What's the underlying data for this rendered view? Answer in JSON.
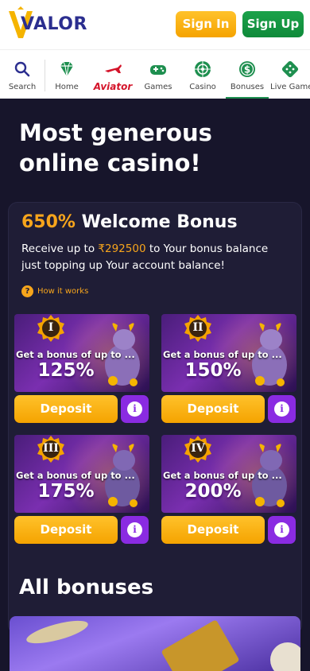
{
  "header": {
    "logo_text": "VALOR",
    "signin_label": "Sign In",
    "signup_label": "Sign Up"
  },
  "nav": {
    "items": [
      {
        "label": "Search",
        "icon": "search-icon"
      },
      {
        "label": "Home",
        "icon": "diamond-icon"
      },
      {
        "label": "Aviator",
        "icon": "plane-icon"
      },
      {
        "label": "Games",
        "icon": "gamepad-icon"
      },
      {
        "label": "Casino",
        "icon": "roulette-icon"
      },
      {
        "label": "Bonuses",
        "icon": "dollar-coin-icon",
        "active": true
      },
      {
        "label": "Live Games",
        "icon": "dice-icon"
      }
    ]
  },
  "hero": {
    "title": "Most generous online casino!"
  },
  "welcome": {
    "percent": "650%",
    "title": " Welcome Bonus",
    "desc_before": "Receive up to ",
    "amount": "₹292500",
    "desc_after": " to Your bonus balance just topping up Your account balance!",
    "how_icon": "?",
    "how_label": "How it works"
  },
  "cards": [
    {
      "numeral": "I",
      "text": "Get a bonus of up to ...",
      "percent": "125%",
      "deposit": "Deposit",
      "info": "i"
    },
    {
      "numeral": "II",
      "text": "Get a bonus of up to ...",
      "percent": "150%",
      "deposit": "Deposit",
      "info": "i"
    },
    {
      "numeral": "III",
      "text": "Get a bonus of up to ...",
      "percent": "175%",
      "deposit": "Deposit",
      "info": "i"
    },
    {
      "numeral": "IV",
      "text": "Get a bonus of up to ...",
      "percent": "200%",
      "deposit": "Deposit",
      "info": "i"
    }
  ],
  "all_bonuses": {
    "title": "All bonuses"
  },
  "colors": {
    "accent": "#f7a51c",
    "signup": "#1ba24a",
    "info": "#8a2be2",
    "background": "#17152b"
  }
}
